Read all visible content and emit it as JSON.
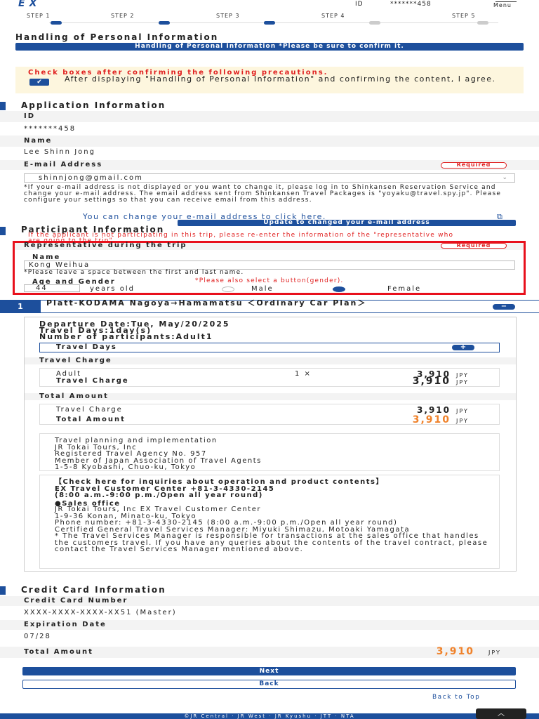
{
  "header": {
    "logo": "EX",
    "id_label": "ID",
    "id_value": "*******458",
    "menu_label": "Menu"
  },
  "steps": [
    "STEP 1",
    "STEP 2",
    "STEP 3",
    "STEP 4",
    "STEP 5"
  ],
  "personal_info": {
    "title": "Handling of Personal Information",
    "button": "Handling of Personal Information *Please be sure to confirm it.",
    "precaution": "Check boxes after confirming the following precautions.",
    "agree_text": "After displaying \"Handling of Personal Information\" and confirming the content, I agree."
  },
  "application": {
    "title": "Application Information",
    "id_label": "ID",
    "id_value": "*******458",
    "name_label": "Name",
    "name_value": "Lee Shinn Jong",
    "email_label": "E-mail Address",
    "required": "Required",
    "email_value": "shinnjong@gmail.com",
    "email_note": "*If your e-mail address is not displayed or you want to change it, please log in to Shinkansen Reservation Service and change your e-mail address. The email address sent from Shinkansen Travel Packages is \"yoyaku@travel.spy.jp\". Please configure your settings so that you can receive email from this address.",
    "change_link": "You can change your e-mail address to click here.",
    "update_button": "Update to changed your e-mail address"
  },
  "participant": {
    "title": "Participant Information",
    "notice": "If the applicant is not participating in this trip, please re-enter the information of the \"representative who are going to the trip\".",
    "rep_label": "Representative during the trip",
    "required": "Required",
    "name_label": "Name",
    "name_value": "Kong Weihua",
    "name_note": "*Please leave a space between the first and last name.",
    "age_label": "Age and Gender",
    "gender_warning": "*Please also select a button(gender).",
    "age_value": "44",
    "years_old": "years old",
    "male": "Male",
    "female": "Female"
  },
  "trip": {
    "number": "1",
    "title": "Platt-KODAMA Nagoya→Hamamatsu ＜Ordinary Car Plan＞",
    "departure": "Departure Date:Tue, May/20/2025",
    "travel_days": "Travel Days:1day(s)",
    "participants": "Number of participants:Adult1",
    "travel_days_toggle": "Travel Days",
    "charge_section": "Travel Charge",
    "adult_label": "Adult",
    "adult_qty": "1 ×",
    "adult_price": "3,910",
    "charge_label": "Travel Charge",
    "charge_price": "3,910",
    "total_section": "Total Amount",
    "total_charge_label": "Travel Charge",
    "total_charge_price": "3,910",
    "total_label": "Total Amount",
    "total_price": "3,910",
    "jpy": "JPY",
    "planning": "Travel planning and implementation\nJR Tokai Tours, Inc\nRegistered Travel Agency No. 957\nMember of Japan Association of Travel Agents\n1-5-8 Kyobashi, Chuo-ku, Tokyo",
    "inquiry_title": "【Check here for inquiries about operation and product contents】\nEX Travel Customer Center +81-3-4330-2145\n(8:00 a.m.-9:00 p.m./Open all year round)",
    "sales_title": "●Sales office",
    "sales_text": "JR Tokai Tours, Inc EX Travel Customer Center\n1-9-36 Konan, Minato-ku, Tokyo\nPhone number: +81-3-4330-2145 (8:00 a.m.-9:00 p.m./Open all year round)\nCertified General Travel Services Manager: Miyuki Shimazu, Motoaki Yamagata\n* The Travel Services Manager is responsible for transactions at the sales office that handles the customers travel. If you have any queries about the contents of the travel contract, please contact the Travel Services Manager mentioned above."
  },
  "credit": {
    "title": "Credit Card Information",
    "number_label": "Credit Card Number",
    "number_value": "XXXX-XXXX-XXXX-XX51 (Master)",
    "exp_label": "Expiration Date",
    "exp_value": "07/28",
    "total_label": "Total Amount",
    "total_value": "3,910",
    "jpy": "JPY"
  },
  "actions": {
    "next": "Next",
    "back": "Back",
    "back_to_top": "Back to Top"
  },
  "footer": "©JR Central · JR West · JR Kyushu · JTT · NTA",
  "colors": {
    "brand": "#1d4f9c",
    "alert": "#e02020",
    "price": "#f0822a"
  }
}
